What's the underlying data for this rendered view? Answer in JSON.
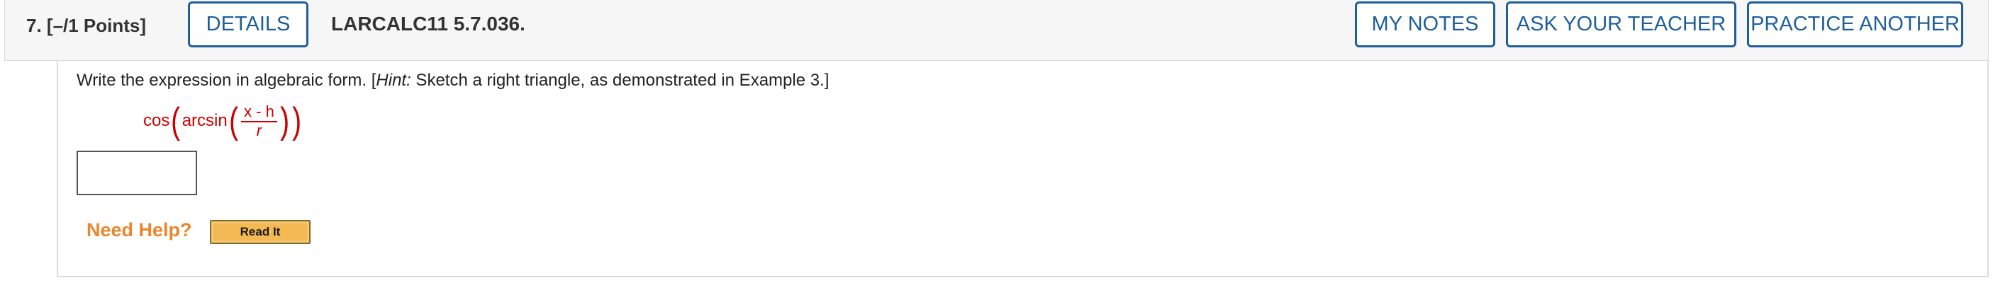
{
  "header": {
    "question_number": "7.  [–/1 Points]",
    "details_button": "DETAILS",
    "question_code": "LARCALC11 5.7.036.",
    "my_notes_button": "MY NOTES",
    "ask_teacher_button": "ASK YOUR TEACHER",
    "practice_another_button": "PRACTICE ANOTHER"
  },
  "problem": {
    "prompt_before": "Write the expression in algebraic form. [",
    "hint_label": "Hint:",
    "prompt_after": " Sketch a right triangle, as demonstrated in Example 3.]",
    "expression": {
      "outer_func": "cos",
      "inner_func": "arcsin",
      "numerator": "x - h",
      "denominator": "r"
    },
    "answer_value": ""
  },
  "help": {
    "label": "Need Help?",
    "read_it_button": "Read It"
  },
  "colors": {
    "accent_blue": "#1f5f99",
    "expression_red": "#cc0000",
    "help_orange": "#e8872b",
    "read_it_gold": "#f2b955"
  }
}
